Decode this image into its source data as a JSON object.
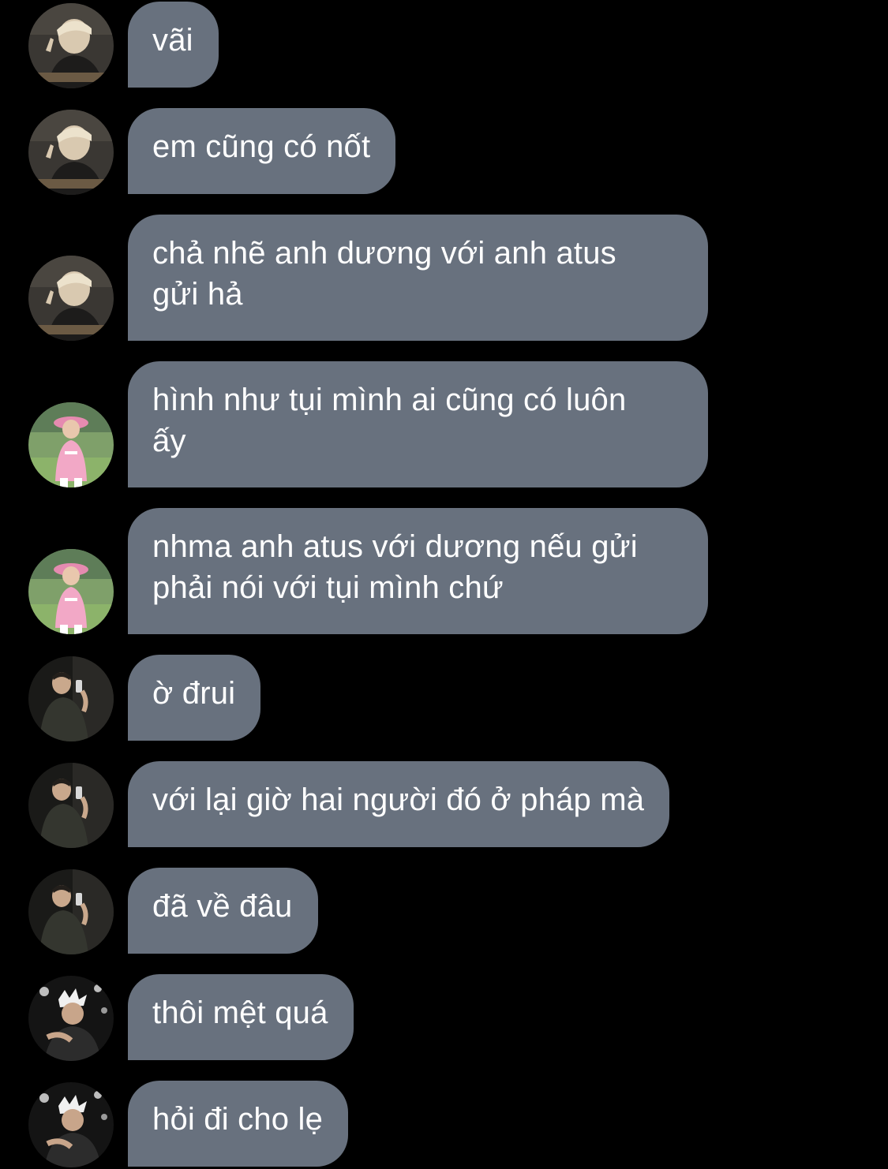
{
  "conversation": {
    "messages": [
      {
        "avatar": "avatar-blonde-peace-sign",
        "text": "vãi"
      },
      {
        "avatar": "avatar-blonde-peace-sign",
        "text": "em cũng có nốt"
      },
      {
        "avatar": "avatar-blonde-peace-sign",
        "lines": [
          "chả nhẽ anh dương với anh atus",
          "gửi hả"
        ]
      },
      {
        "avatar": "avatar-pink-hat-outdoor",
        "lines": [
          "hình như tụi mình ai cũng có luôn",
          "ấy"
        ]
      },
      {
        "avatar": "avatar-pink-hat-outdoor",
        "lines": [
          "nhma anh atus với dương nếu gửi",
          "phải nói với tụi mình chứ"
        ]
      },
      {
        "avatar": "avatar-mirror-selfie",
        "text": "ờ đrui"
      },
      {
        "avatar": "avatar-mirror-selfie",
        "text": "với lại giờ hai người đó ở pháp mà"
      },
      {
        "avatar": "avatar-mirror-selfie",
        "text": "đã về đâu"
      },
      {
        "avatar": "avatar-white-hair-dark",
        "text": "thôi mệt quá"
      },
      {
        "avatar": "avatar-white-hair-dark",
        "text": "hỏi đi cho lẹ"
      }
    ]
  },
  "colors": {
    "background": "#000000",
    "bubble": "#68717e",
    "text": "#ffffff"
  }
}
